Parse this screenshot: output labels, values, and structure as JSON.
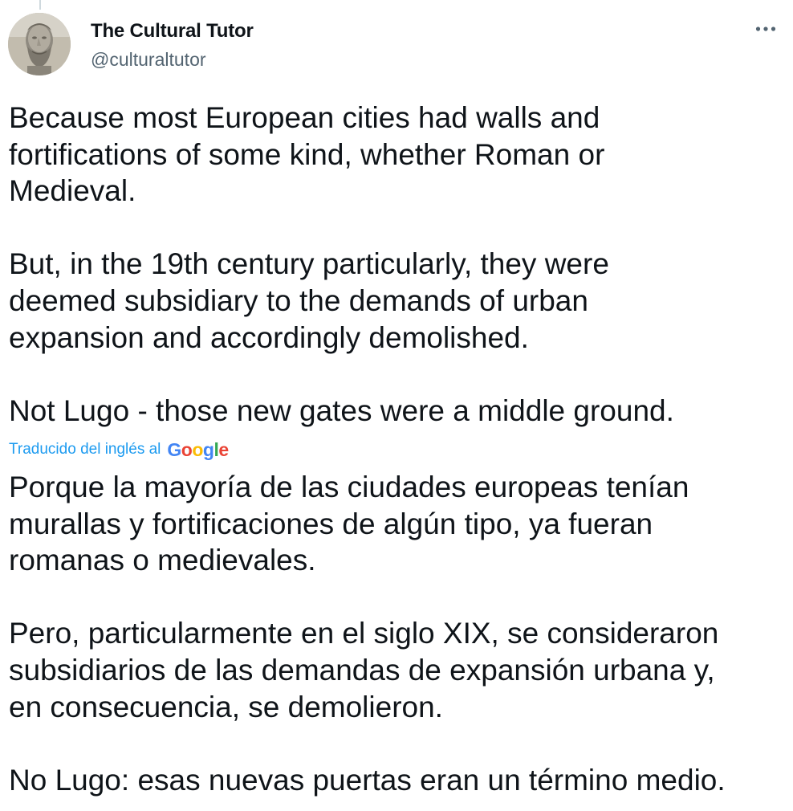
{
  "author": {
    "name": "The Cultural Tutor",
    "handle": "@culturaltutor",
    "avatar_icon": "marble-bust-avatar"
  },
  "more_menu": {
    "icon": "more-horizontal-icon"
  },
  "tweet": {
    "original_text": "Because most European cities had walls and\nfortifications of some kind, whether Roman or\nMedieval.\n\nBut, in the 19th century particularly, they were\ndeemed subsidiary to the demands of urban\nexpansion and accordingly demolished.\n\nNot Lugo - those new gates were a middle ground.",
    "translated_by": "Traducido del inglés al",
    "translator_logo": "Google",
    "translated_text": "Porque la mayoría de las ciudades europeas tenían\nmurallas y fortificaciones de algún tipo, ya fueran\nromanas o medievales.\n\nPero, particularmente en el siglo XIX, se consideraron\nsubsidiarios de las demandas de expansión urbana y,\nen consecuencia, se demolieron.\n\nNo Lugo: esas nuevas puertas eran un término medio."
  },
  "colors": {
    "text": "#0f1419",
    "secondary": "#536471",
    "link": "#1d9bf0"
  }
}
